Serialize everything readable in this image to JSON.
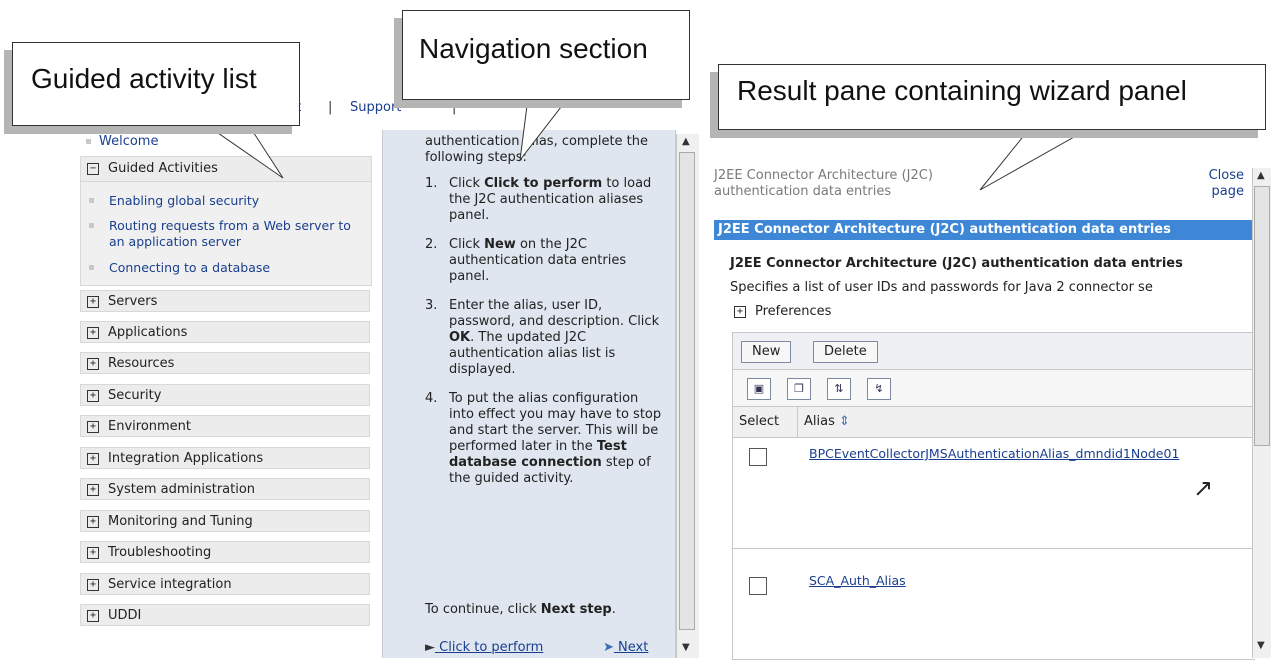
{
  "callouts": {
    "guided": "Guided activity list",
    "navigation": "Navigation section",
    "result": "Result pane containing wizard panel"
  },
  "topbar": {
    "partial_link": "ut",
    "separator": "|",
    "support": "Support"
  },
  "left_nav": {
    "welcome": "Welcome",
    "guided_activities": "Guided Activities",
    "guided_items": [
      "Enabling global security",
      "Routing requests from a Web server to an application server",
      "Connecting to a database"
    ],
    "categories": [
      "Servers",
      "Applications",
      "Resources",
      "Security",
      "Environment",
      "Integration Applications",
      "System administration",
      "Monitoring and Tuning",
      "Troubleshooting",
      "Service integration",
      "UDDI"
    ]
  },
  "navigation": {
    "intro": "authentication alias, complete the following steps:",
    "steps": [
      {
        "num": "1.",
        "pre": "Click ",
        "bold": "Click to perform",
        "post": " to load the J2C authentication aliases panel."
      },
      {
        "num": "2.",
        "pre": "Click ",
        "bold": "New",
        "post": " on the J2C authentication data entries panel."
      },
      {
        "num": "3.",
        "pre": "Enter the alias, user ID, password, and description. Click ",
        "bold": "OK",
        "post": ". The updated J2C authentication alias list is displayed."
      },
      {
        "num": "4.",
        "pre": "To put the alias configuration into effect you may have to stop and start the server. This will be performed later in the ",
        "bold": "Test database connection",
        "post": " step of the guided activity."
      }
    ],
    "continue_pre": "To continue, click ",
    "continue_bold": "Next step",
    "continue_post": ".",
    "click_to_perform": "Click to perform",
    "next": "Next"
  },
  "result": {
    "title": "J2EE Connector Architecture (J2C) authentication data entries",
    "close": "Close page",
    "bar_title": "J2EE Connector Architecture (J2C) authentication data entries",
    "subtitle": "J2EE Connector Architecture (J2C) authentication data entries",
    "description": "Specifies a list of user IDs and passwords for Java 2 connector se",
    "preferences": "Preferences",
    "buttons": {
      "new": "New",
      "delete": "Delete"
    },
    "columns": {
      "select": "Select",
      "alias": "Alias"
    },
    "rows": [
      {
        "alias": "BPCEventCollectorJMSAuthenticationAlias_dmndid1Node01"
      },
      {
        "alias": "SCA_Auth_Alias"
      }
    ]
  }
}
